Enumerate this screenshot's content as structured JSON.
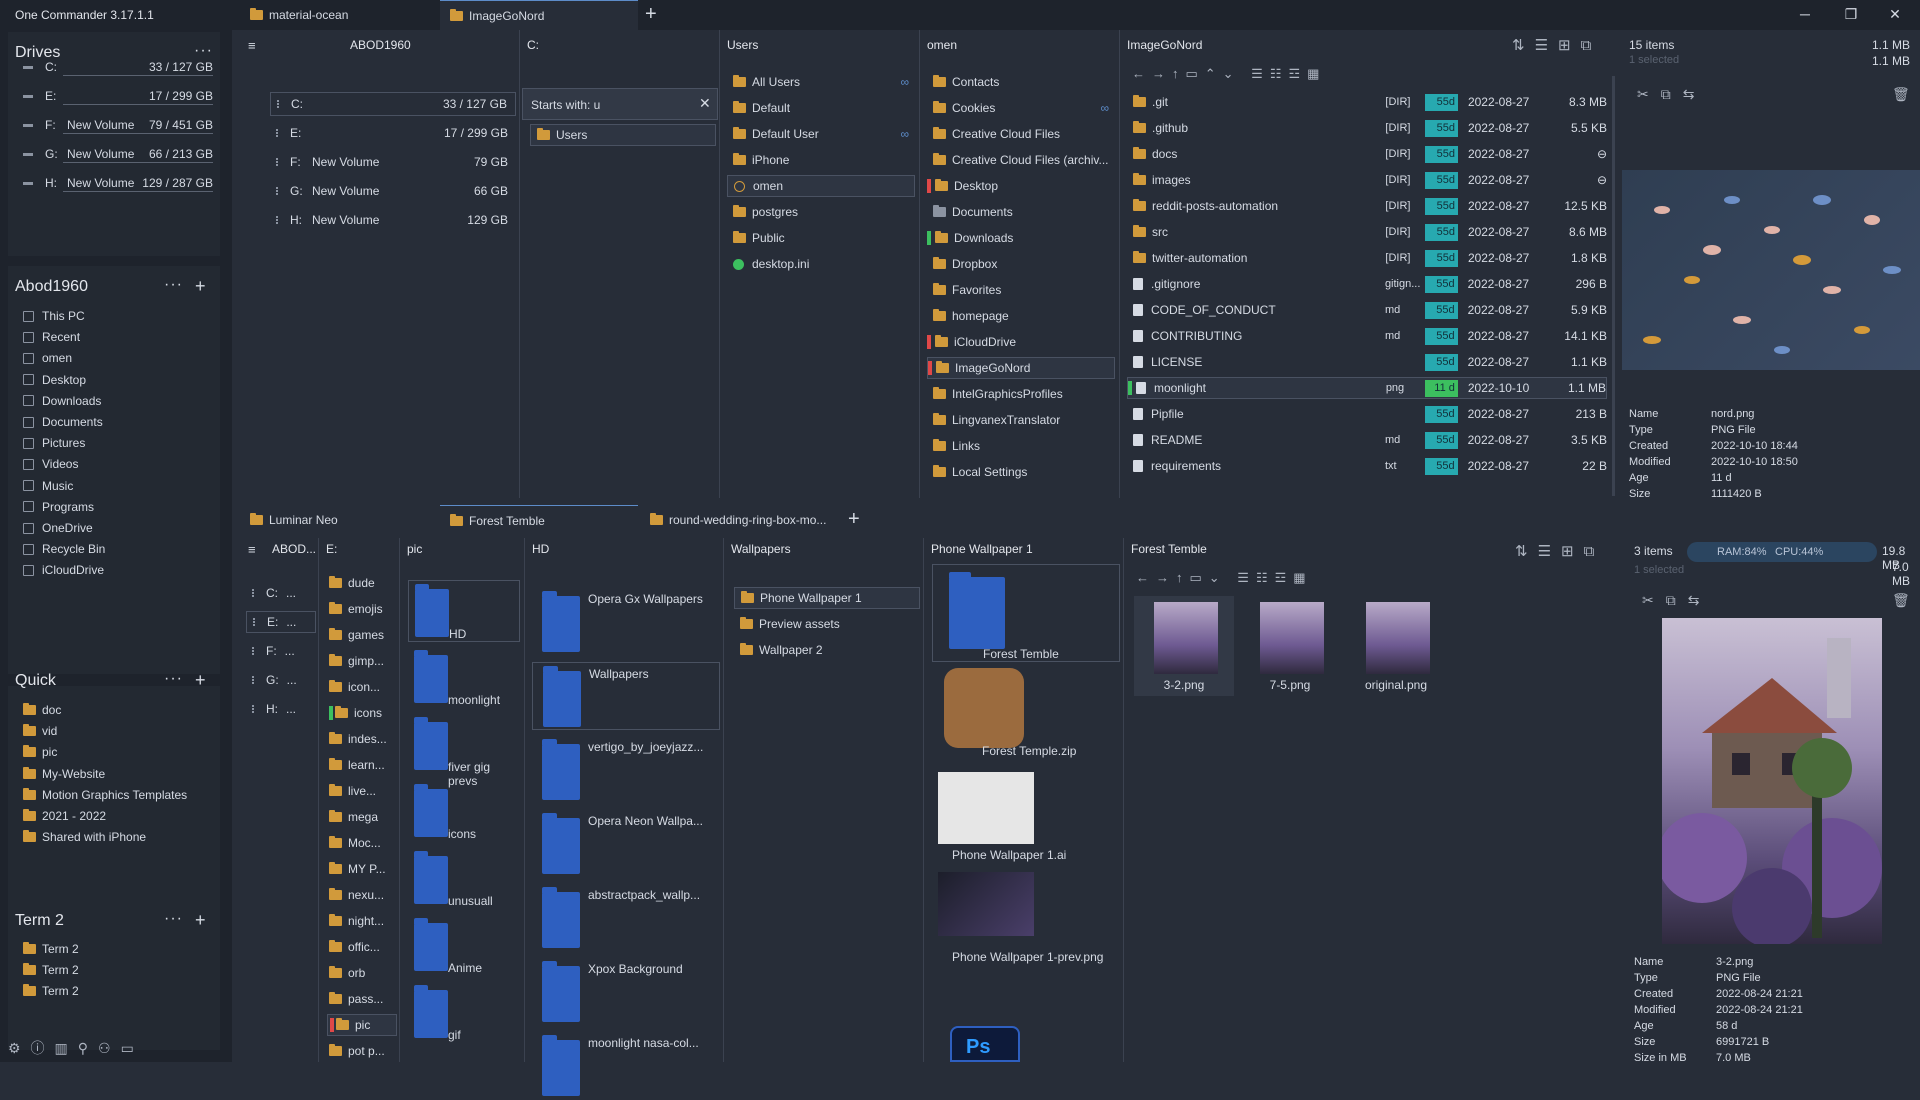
{
  "app": {
    "title": "One Commander 3.17.1.1"
  },
  "top_tabs": [
    {
      "label": "material-ocean"
    },
    {
      "label": "ImageGoNord"
    }
  ],
  "window_buttons": {
    "minimize": "─",
    "restore": "❐",
    "close": "✕"
  },
  "sidebar": {
    "drives_title": "Drives",
    "drives": [
      {
        "letter": "C:",
        "name": "",
        "size": "33 / 127 GB"
      },
      {
        "letter": "E:",
        "name": "",
        "size": "17 / 299 GB"
      },
      {
        "letter": "F:",
        "name": "New Volume",
        "size": "79 / 451 GB"
      },
      {
        "letter": "G:",
        "name": "New Volume",
        "size": "66 / 213 GB"
      },
      {
        "letter": "H:",
        "name": "New Volume",
        "size": "129 / 287 GB"
      }
    ],
    "user_title": "Abod1960",
    "user_items": [
      "This PC",
      "Recent",
      "omen",
      "Desktop",
      "Downloads",
      "Documents",
      "Pictures",
      "Videos",
      "Music",
      "Programs",
      "OneDrive",
      "Recycle Bin",
      "iCloudDrive"
    ],
    "quick_title": "Quick",
    "quick_items": [
      "doc",
      "vid",
      "pic",
      "My-Website",
      "Motion Graphics Templates",
      "2021 - 2022",
      "Shared with iPhone"
    ],
    "term_title": "Term 2",
    "term_items": [
      "Term 2",
      "Term 2",
      "Term 2"
    ],
    "dots": "···",
    "plus": "+"
  },
  "top_panel": {
    "columns": [
      "ABOD1960",
      "C:",
      "Users",
      "omen",
      "ImageGoNord"
    ],
    "abod_drives": [
      {
        "letter": "C:",
        "name": "",
        "size": "33 / 127 GB"
      },
      {
        "letter": "E:",
        "name": "",
        "size": "17 / 299 GB"
      },
      {
        "letter": "F:",
        "name": "New Volume",
        "size": "79 GB"
      },
      {
        "letter": "G:",
        "name": "New Volume",
        "size": "66 GB"
      },
      {
        "letter": "H:",
        "name": "New Volume",
        "size": "129 GB"
      }
    ],
    "filter_text": "Starts with: u",
    "c_items": [
      "Users"
    ],
    "users_items": [
      "All Users",
      "Default",
      "Default User",
      "iPhone",
      "omen",
      "postgres",
      "Public",
      "desktop.ini"
    ],
    "omen_items": [
      "Contacts",
      "Cookies",
      "Creative Cloud Files",
      "Creative Cloud Files (archiv...",
      "Desktop",
      "Documents",
      "Downloads",
      "Dropbox",
      "Favorites",
      "homepage",
      "iCloudDrive",
      "ImageGoNord",
      "IntelGraphicsProfiles",
      "LingvanexTranslator",
      "Links",
      "Local Settings"
    ],
    "files": [
      {
        "name": ".git",
        "type": "[DIR]",
        "age": "55d",
        "date": "2022-08-27",
        "size": "8.3 MB"
      },
      {
        "name": ".github",
        "type": "[DIR]",
        "age": "55d",
        "date": "2022-08-27",
        "size": "5.5 KB"
      },
      {
        "name": "docs",
        "type": "[DIR]",
        "age": "55d",
        "date": "2022-08-27",
        "size": "⊖"
      },
      {
        "name": "images",
        "type": "[DIR]",
        "age": "55d",
        "date": "2022-08-27",
        "size": "⊖"
      },
      {
        "name": "reddit-posts-automation",
        "type": "[DIR]",
        "age": "55d",
        "date": "2022-08-27",
        "size": "12.5 KB"
      },
      {
        "name": "src",
        "type": "[DIR]",
        "age": "55d",
        "date": "2022-08-27",
        "size": "8.6 MB"
      },
      {
        "name": "twitter-automation",
        "type": "[DIR]",
        "age": "55d",
        "date": "2022-08-27",
        "size": "1.8 KB"
      },
      {
        "name": ".gitignore",
        "type": "gitign...",
        "age": "55d",
        "date": "2022-08-27",
        "size": "296 B"
      },
      {
        "name": "CODE_OF_CONDUCT",
        "type": "md",
        "age": "55d",
        "date": "2022-08-27",
        "size": "5.9 KB"
      },
      {
        "name": "CONTRIBUTING",
        "type": "md",
        "age": "55d",
        "date": "2022-08-27",
        "size": "14.1 KB"
      },
      {
        "name": "LICENSE",
        "type": "",
        "age": "55d",
        "date": "2022-08-27",
        "size": "1.1 KB"
      },
      {
        "name": "moonlight",
        "type": "png",
        "age": "11 d",
        "date": "2022-10-10",
        "size": "1.1 MB"
      },
      {
        "name": "Pipfile",
        "type": "",
        "age": "55d",
        "date": "2022-08-27",
        "size": "213 B"
      },
      {
        "name": "README",
        "type": "md",
        "age": "55d",
        "date": "2022-08-27",
        "size": "3.5 KB"
      },
      {
        "name": "requirements",
        "type": "txt",
        "age": "55d",
        "date": "2022-08-27",
        "size": "22 B"
      }
    ],
    "items_count": "15 items",
    "selected": "1 selected",
    "total1": "1.1 MB",
    "total2": "1.1 MB",
    "info": {
      "Name": "nord.png",
      "Type": "PNG File",
      "Created": "2022-10-10  18:44",
      "Modified": "2022-10-10  18:50",
      "Age": "11 d",
      "Size": "1111420 B"
    }
  },
  "bottom_tabs": [
    {
      "label": "Luminar Neo"
    },
    {
      "label": "Forest Temble"
    },
    {
      "label": "round-wedding-ring-box-mo..."
    }
  ],
  "bottom_panel": {
    "columns": [
      "ABOD...",
      "E:",
      "pic",
      "HD",
      "Wallpapers",
      "Phone Wallpaper 1",
      "Forest Temble"
    ],
    "abod_letters": [
      "C:",
      "E:",
      "F:",
      "G:",
      "H:"
    ],
    "e_items": [
      "dude",
      "emojis",
      "games",
      "gimp...",
      "icon...",
      "icons",
      "indes...",
      "learn...",
      "live...",
      "mega",
      "Moc...",
      "MY P...",
      "nexu...",
      "night...",
      "offic...",
      "orb",
      "pass...",
      "pic",
      "pot p..."
    ],
    "pic_items": [
      "HD",
      "moonlight",
      "fiver gig prevs",
      "icons",
      "unusuall",
      "Anime",
      "gif"
    ],
    "hd_items": [
      "Opera Gx Wallpapers",
      "Wallpapers",
      "vertigo_by_joeyjazz...",
      "Opera Neon Wallpa...",
      "abstractpack_wallp...",
      "Xpox Background",
      "moonlight nasa-col..."
    ],
    "wallpapers_items": [
      "Phone Wallpaper 1",
      "Preview assets",
      "Wallpaper 2"
    ],
    "phone_items": [
      "Forest Temble",
      "Forest Temple.zip",
      "Phone Wallpaper 1.ai",
      "Phone Wallpaper 1-prev.png"
    ],
    "forest_items": [
      "3-2.png",
      "7-5.png",
      "original.png"
    ],
    "items_count": "3 items",
    "selected": "1 selected",
    "ram": "RAM:84%",
    "cpu": "CPU:44%",
    "total1": "19.8 MB",
    "total2": "7.0 MB",
    "info": {
      "Name": "3-2.png",
      "Type": "PNG File",
      "Created": "2022-08-24  21:21",
      "Modified": "2022-08-24  21:21",
      "Age": "58 d",
      "Size": "6991721 B",
      "Size in MB": "7.0 MB"
    }
  },
  "colors": {
    "bg": "#272d38",
    "sidebar": "#1e232c",
    "accent": "#5d8cc9",
    "age_teal": "#27a9b0",
    "age_green": "#3cbf5f",
    "folder": "#d19a3b"
  }
}
